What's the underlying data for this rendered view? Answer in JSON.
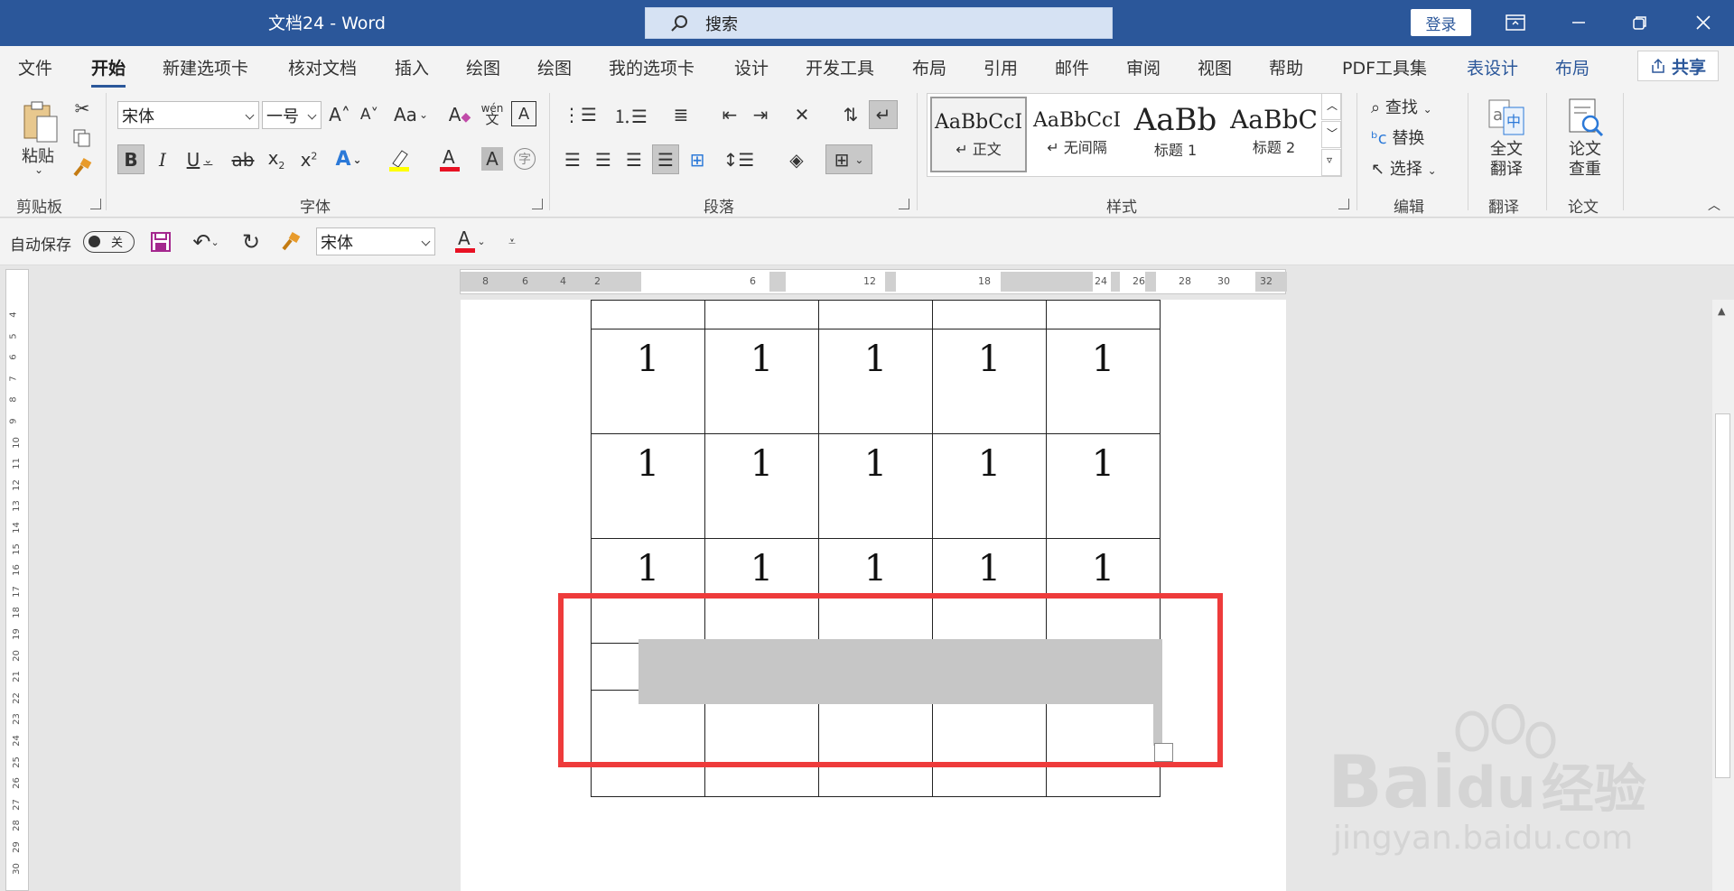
{
  "window": {
    "title": "文档24  -  Word",
    "search_label": "搜索",
    "login_label": "登录"
  },
  "tabs": [
    {
      "label": "文件"
    },
    {
      "label": "开始"
    },
    {
      "label": "新建选项卡"
    },
    {
      "label": "核对文档"
    },
    {
      "label": "插入"
    },
    {
      "label": "绘图"
    },
    {
      "label": "绘图"
    },
    {
      "label": "我的选项卡"
    },
    {
      "label": "设计"
    },
    {
      "label": "开发工具"
    },
    {
      "label": "布局"
    },
    {
      "label": "引用"
    },
    {
      "label": "邮件"
    },
    {
      "label": "审阅"
    },
    {
      "label": "视图"
    },
    {
      "label": "帮助"
    },
    {
      "label": "PDF工具集"
    },
    {
      "label": "表设计"
    },
    {
      "label": "布局"
    }
  ],
  "share_label": "共享",
  "ribbon": {
    "clipboard": {
      "paste_label": "粘贴",
      "group_label": "剪贴板"
    },
    "font": {
      "font_name": "宋体",
      "font_size": "一号",
      "case_label": "Aa",
      "phonetic_label": "wén",
      "group_label": "字体"
    },
    "paragraph": {
      "group_label": "段落"
    },
    "styles": {
      "group_label": "样式",
      "items": [
        {
          "sample": "AaBbCcI",
          "name": "↵ 正文"
        },
        {
          "sample": "AaBbCcI",
          "name": "↵ 无间隔"
        },
        {
          "sample": "AaBb",
          "name": "标题 1"
        },
        {
          "sample": "AaBbC",
          "name": "标题 2"
        }
      ]
    },
    "editing": {
      "find_label": "查找",
      "replace_label": "替换",
      "select_label": "选择",
      "group_label": "编辑"
    },
    "translate": {
      "line1": "全文",
      "line2": "翻译",
      "group_label": "翻译"
    },
    "paper": {
      "line1": "论文",
      "line2": "查重",
      "group_label": "论文"
    }
  },
  "qat": {
    "autosave_label": "自动保存",
    "toggle_state": "关",
    "font_name": "宋体"
  },
  "ruler_h": [
    "8",
    "6",
    "4",
    "2",
    "",
    "6",
    "12",
    "18",
    "24",
    "26",
    "28",
    "30",
    "32"
  ],
  "ruler_v": [
    "4",
    "5",
    "6",
    "7",
    "8",
    "9",
    "10",
    "11",
    "12",
    "13",
    "14",
    "15",
    "16",
    "17",
    "18",
    "19",
    "20",
    "21",
    "22",
    "23",
    "24",
    "25",
    "26",
    "27",
    "28",
    "29",
    "30"
  ],
  "table": {
    "rows": [
      [
        "",
        "",
        "",
        "",
        ""
      ],
      [
        "1",
        "1",
        "1",
        "1",
        "1"
      ],
      [
        "1",
        "1",
        "1",
        "1",
        "1"
      ],
      [
        "1",
        "1",
        "1",
        "1",
        "1"
      ],
      [
        "",
        "",
        "",
        "",
        ""
      ],
      [
        "",
        "",
        "",
        "",
        ""
      ]
    ]
  },
  "watermark": {
    "brand": "Bai",
    "brand2": "du",
    "cn": "经验",
    "url": "jingyan.baidu.com"
  },
  "colors": {
    "accent": "#2b579a",
    "highlight_box": "#ee3b3b",
    "selection": "#c6c6c6",
    "font_color": "#e81123",
    "highlight_color": "#ffff00"
  }
}
